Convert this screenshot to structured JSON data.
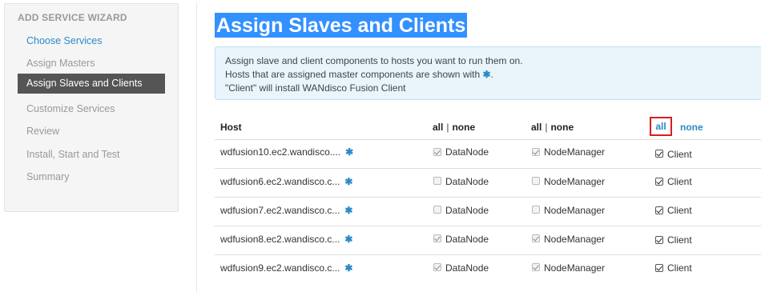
{
  "sidebar": {
    "title": "ADD SERVICE WIZARD",
    "items": [
      {
        "label": "Choose Services",
        "state": "link"
      },
      {
        "label": "Assign Masters",
        "state": "disabled"
      },
      {
        "label": "Assign Slaves and Clients",
        "state": "active"
      },
      {
        "label": "Customize Services",
        "state": "disabled"
      },
      {
        "label": "Review",
        "state": "disabled"
      },
      {
        "label": "Install, Start and Test",
        "state": "disabled"
      },
      {
        "label": "Summary",
        "state": "disabled"
      }
    ]
  },
  "main": {
    "title": "Assign Slaves and Clients",
    "info": {
      "line1": "Assign slave and client components to hosts you want to run them on.",
      "line2": "Hosts that are assigned master components are shown with",
      "line2_suffix": ".",
      "line3": "\"Client\" will install WANdisco Fusion Client",
      "star_icon": "✱"
    },
    "table": {
      "host_header": "Host",
      "datanode_header": {
        "all": "all",
        "sep": "|",
        "none": "none"
      },
      "nodemanager_header": {
        "all": "all",
        "sep": "|",
        "none": "none"
      },
      "client_header": {
        "all": "all",
        "none": "none"
      },
      "rows": [
        {
          "host": "wdfusion10.ec2.wandisco....",
          "datanode": true,
          "nodemanager": true,
          "client": true
        },
        {
          "host": "wdfusion6.ec2.wandisco.c...",
          "datanode": false,
          "nodemanager": false,
          "client": true
        },
        {
          "host": "wdfusion7.ec2.wandisco.c...",
          "datanode": false,
          "nodemanager": false,
          "client": true
        },
        {
          "host": "wdfusion8.ec2.wandisco.c...",
          "datanode": true,
          "nodemanager": true,
          "client": true
        },
        {
          "host": "wdfusion9.ec2.wandisco.c...",
          "datanode": true,
          "nodemanager": true,
          "client": true
        }
      ],
      "datanode_label": "DataNode",
      "nodemanager_label": "NodeManager",
      "client_label": "Client"
    }
  },
  "colors": {
    "accent": "#2a8ac8",
    "active_bg": "#555555",
    "title_highlight": "#3390ff",
    "callout": "#d81e1e"
  }
}
